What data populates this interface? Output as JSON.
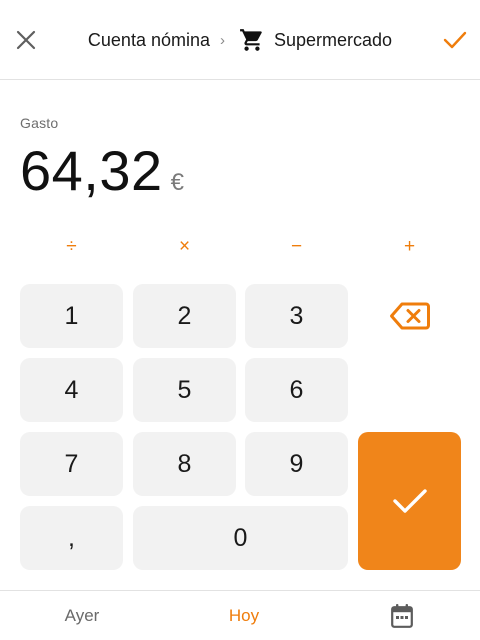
{
  "header": {
    "account": "Cuenta nómina",
    "separator": "›",
    "category": "Supermercado",
    "icons": {
      "close": "close-icon",
      "category": "cart-icon",
      "confirm": "check-icon"
    }
  },
  "amount": {
    "label": "Gasto",
    "value": "64,32",
    "currency": "€"
  },
  "operators": {
    "divide": "÷",
    "multiply": "×",
    "subtract": "−",
    "add": "+"
  },
  "keypad": {
    "one": "1",
    "two": "2",
    "three": "3",
    "four": "4",
    "five": "5",
    "six": "6",
    "seven": "7",
    "eight": "8",
    "nine": "9",
    "comma": ",",
    "zero": "0",
    "icons": {
      "backspace": "backspace-icon",
      "confirm": "check-icon"
    }
  },
  "footer": {
    "yesterday": "Ayer",
    "today": "Hoy",
    "icons": {
      "calendar": "calendar-icon"
    }
  },
  "colors": {
    "accent": "#ef7d0c",
    "key_background": "#f2f2f2",
    "confirm_background": "#f0851a"
  }
}
